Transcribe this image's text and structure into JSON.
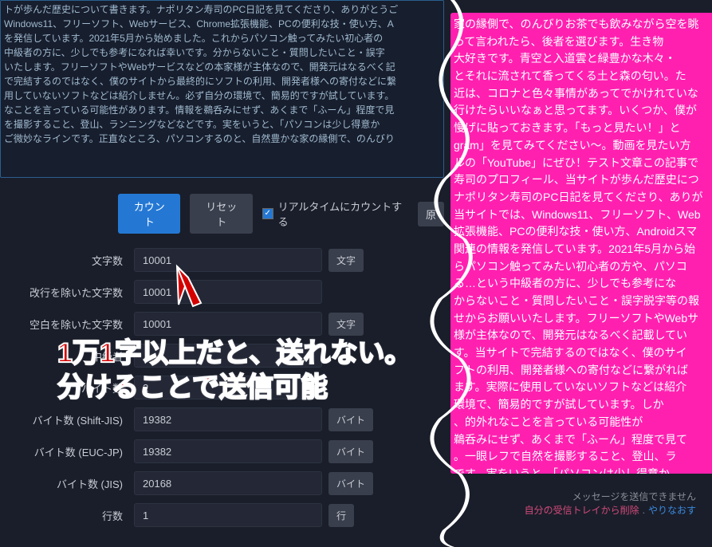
{
  "left_desc_text": "トが歩んだ歴史について書きます。ナポリタン寿司のPC日記を見てくださり、ありがとうご\nWindows11、フリーソフト、Webサービス、Chrome拡張機能、PCの便利な技・使い方、A\nを発信しています。2021年5月から始めました。これからパソコン触ってみたい初心者の\n中級者の方に、少しでも参考になれば幸いです。分からないこと・質問したいこと・誤字\nいたします。フリーソフトやWebサービスなどの本家様が主体なので、開発元はなるべく記\nで完結するのではなく、僕のサイトから最終的にソフトの利用、開発者様への寄付などに繋\n用していないソフトなどは紹介しません。必ず自分の環境で、簡易的ですが試しています。\nなことを言っている可能性があります。情報を鵜呑みにせず、あくまで「ふーん」程度で見\nを撮影すること、登山、ランニングなどなどです。実をいうと、「パソコンは少し得意か\nご微妙なラインです。正直なところ、パソコンするのと、自然豊かな家の縁側で、のんびり",
  "buttons": {
    "count": "カウント",
    "reset": "リセット",
    "realtime_label": "リアルタイムにカウントする",
    "realtime_checked": true,
    "original": "原"
  },
  "fields": [
    {
      "label": "文字数",
      "value": "10001",
      "unit": "文字"
    },
    {
      "label": "改行を除いた文字数",
      "value": "10001",
      "unit": ""
    },
    {
      "label": "空白を除いた文字数",
      "value": "10001",
      "unit": "文字"
    },
    {
      "label": "中級者",
      "value": "",
      "unit": ""
    },
    {
      "label": "バイト数",
      "value": "2",
      "unit": ""
    },
    {
      "label": "バイト数 (Shift-JIS)",
      "value": "19382",
      "unit": "バイト"
    },
    {
      "label": "バイト数 (EUC-JP)",
      "value": "19382",
      "unit": "バイト"
    },
    {
      "label": "バイト数 (JIS)",
      "value": "20168",
      "unit": "バイト"
    },
    {
      "label": "行数",
      "value": "1",
      "unit": "行"
    }
  ],
  "overlay": {
    "line1": "1万1字以上だと、送れない。",
    "line2": "分けることで送信可能"
  },
  "right_pink_text": "家の縁側で、のんびりお茶でも飲みながら空を眺\nって言われたら、後者を選びます。生き物\n大好きです。青空と入道雲と緑豊かな木々・\nとそれに流されて香ってくる土と森の匂い。た\n近は、コロナと色々事情があってでかけれていな\n行けたらいいなぁと思ってます。いくつか、僕が\n慢げに貼っておきます。「もっと見たい！」と\ngram」を見てみてください〜。動画を見たい方\nルの「YouTube」にぜひ！テスト文章この記事で\n寿司のプロフィール、当サイトが歩んだ歴史につ\nナポリタン寿司のPC日記を見てくださり、ありが\n当サイトでは、Windows11、フリーソフト、Web\n拡張機能、PCの便利な技・使い方、Androidスマ\n関連の情報を発信しています。2021年5月から始\nらパソコン触ってみたい初心者の方や、パソコ\nる…という中級者の方に、少しでも参考にな\nからないこと・質問したいこと・誤字脱字等の報\nせからお願いいたします。フリーソフトやWebサ\n様が主体なので、開発元はなるべく記載してい\nす。当サイトで完結するのではなく、僕のサイ\nフトの利用、開発者様への寄付などに繋がれば\nます。実際に使用していないソフトなどは紹介\n環境で、簡易的ですが試しています。しか\n、的外れなことを言っている可能性が\n鵜呑みにせず、あくまで「ふーん」程度で見て\n。一眼レフで自然を撮影すること、登山、ラ\nです。実をいうと、「パソコンは少し得意か\nで、好きかどうか聞かれると微妙なラインです。\nパソコンするのと、自然豊かな家の縁側で、のん\nま",
  "status": {
    "error": "メッセージを送信できません",
    "delete_link": "自分の受信トレイから削除",
    "retry_link": "やりなおす"
  }
}
